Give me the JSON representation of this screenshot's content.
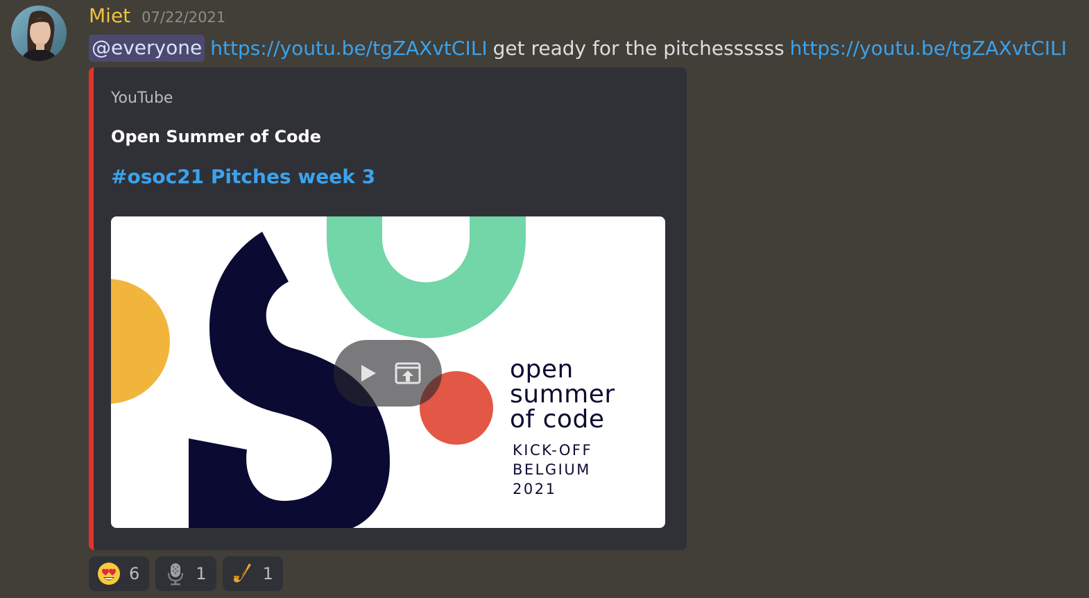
{
  "message": {
    "author": "Miet",
    "timestamp": "07/22/2021",
    "mention": "@everyone",
    "link1": "https://youtu.be/tgZAXvtCILI",
    "text": "get ready for the pitchessssss",
    "link2": "https://youtu.be/tgZAXvtCILI",
    "colors": {
      "username": "#f0c33c",
      "link": "#3aa3ee",
      "embed_border": "#e5312b"
    }
  },
  "embed": {
    "provider": "YouTube",
    "author": "Open Summer of Code",
    "title": "#osoc21 Pitches week 3",
    "thumbnail": {
      "lines": [
        "open",
        "summer",
        "of code"
      ],
      "sub_lines": [
        "KICK-OFF",
        "BELGIUM",
        "2021"
      ]
    },
    "overlay_icons": [
      "play-icon",
      "open-external-icon"
    ]
  },
  "reactions": [
    {
      "emoji": "heart-eyes-emoji",
      "count": "6"
    },
    {
      "emoji": "microphone-emoji",
      "count": "1"
    },
    {
      "emoji": "saxophone-emoji",
      "count": "1"
    }
  ]
}
